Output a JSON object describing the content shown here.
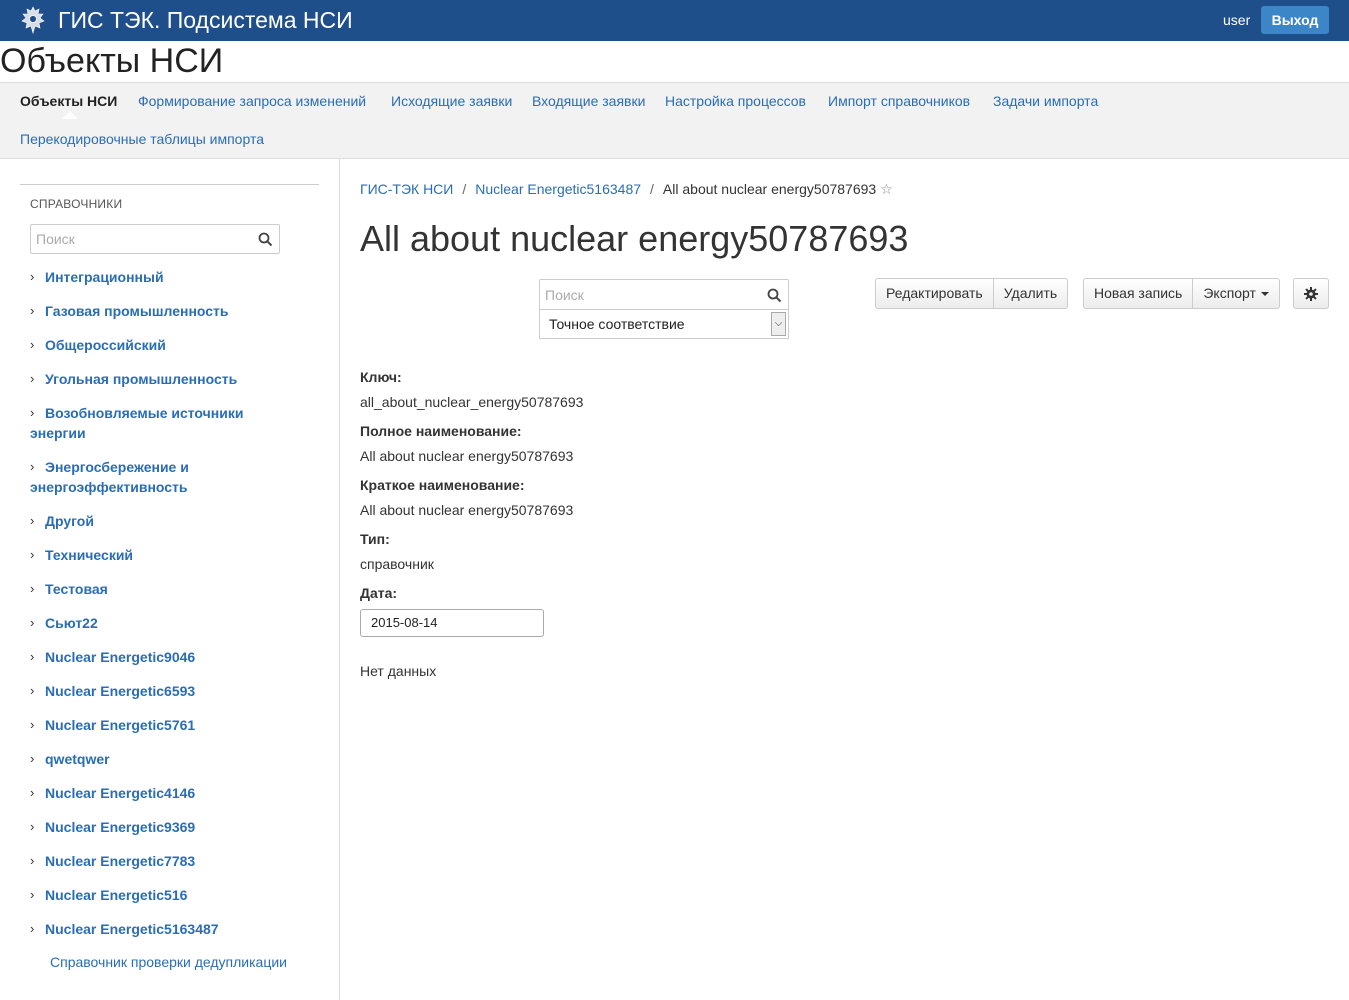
{
  "header": {
    "app_title": "ГИС ТЭК. Подсистема НСИ",
    "user": "user",
    "logout_label": "Выход",
    "brand_color": "#1f4f8b"
  },
  "page_title": "Объекты НСИ",
  "nav": {
    "items": [
      "Объекты НСИ",
      "Формирование запроса изменений",
      "Исходящие заявки",
      "Входящие заявки",
      "Настройка процессов",
      "Импорт справочников",
      "Задачи импорта",
      "Перекодировочные таблицы импорта"
    ],
    "active": "Объекты НСИ"
  },
  "sidebar": {
    "heading": "СПРАВОЧНИКИ",
    "search_placeholder": "Поиск",
    "items": [
      "Интеграционный",
      "Газовая промышленность",
      "Общероссийский",
      "Угольная промышленность",
      "Возобновляемые источники энергии",
      "Энергосбережение и энергоэффективность",
      "Другой",
      "Технический",
      "Тестовая",
      "Сьют22",
      "Nuclear Energetic9046",
      "Nuclear Energetic6593",
      "Nuclear Energetic5761",
      "qwetqwer",
      "Nuclear Energetic4146",
      "Nuclear Energetic9369",
      "Nuclear Energetic7783",
      "Nuclear Energetic516",
      "Nuclear Energetic5163487"
    ],
    "leaf": "Справочник проверки дедупликации"
  },
  "breadcrumb": {
    "items": [
      "ГИС-ТЭК НСИ",
      "Nuclear Energetic5163487"
    ],
    "current": "All about nuclear energy50787693"
  },
  "record": {
    "title": "All about nuclear energy50787693",
    "search_placeholder": "Поиск",
    "match_mode": "Точное соответствие",
    "buttons": {
      "edit": "Редактировать",
      "delete": "Удалить",
      "new_record": "Новая запись",
      "export": "Экспорт"
    },
    "fields": [
      {
        "label": "Ключ:",
        "value": "all_about_nuclear_energy50787693"
      },
      {
        "label": "Полное наименование:",
        "value": "All about nuclear energy50787693"
      },
      {
        "label": "Краткое наименование:",
        "value": "All about nuclear energy50787693"
      },
      {
        "label": "Тип:",
        "value": "справочник"
      }
    ],
    "date_label": "Дата:",
    "date_value": "2015-08-14",
    "empty_text": "Нет данных"
  }
}
